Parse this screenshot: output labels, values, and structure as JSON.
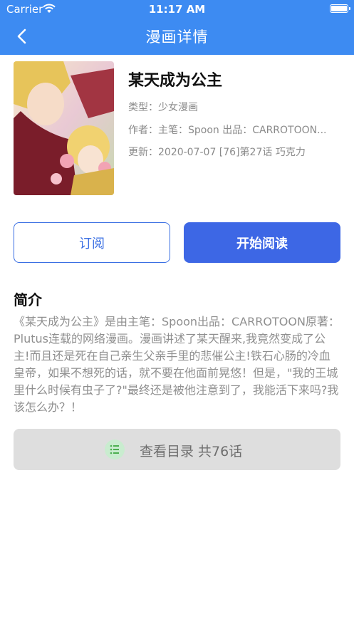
{
  "status_bar": {
    "carrier": "Carrier",
    "time": "11:17 AM"
  },
  "nav": {
    "title": "漫画详情",
    "back_icon": "chevron-left-icon"
  },
  "comic": {
    "title": "某天成为公主",
    "type": "类型：少女漫画",
    "author": "作者：主笔：Spoon 出品：CARROTOON...",
    "updated": "更新：2020-07-07 [76]第27话 巧克力"
  },
  "actions": {
    "subscribe": "订阅",
    "read": "开始阅读"
  },
  "intro": {
    "heading": "简介",
    "text": "《某天成为公主》是由主笔：Spoon出品：CARROTOON原著：Plutus连载的网络漫画。漫画讲述了某天醒来,我竟然变成了公主!而且还是死在自己亲生父亲手里的悲催公主!铁石心肠的冷血皇帝，如果不想死的话，就不要在他面前晃悠！但是，\"我的王城里什么时候有虫子了?\"最终还是被他注意到了，我能活下来吗?我该怎么办？！"
  },
  "toc": {
    "label": "查看目录 共76话",
    "icon": "list-icon"
  },
  "colors": {
    "accent": "#3d8bf2",
    "button": "#3d67e5",
    "toc_icon": "#4caf50"
  }
}
